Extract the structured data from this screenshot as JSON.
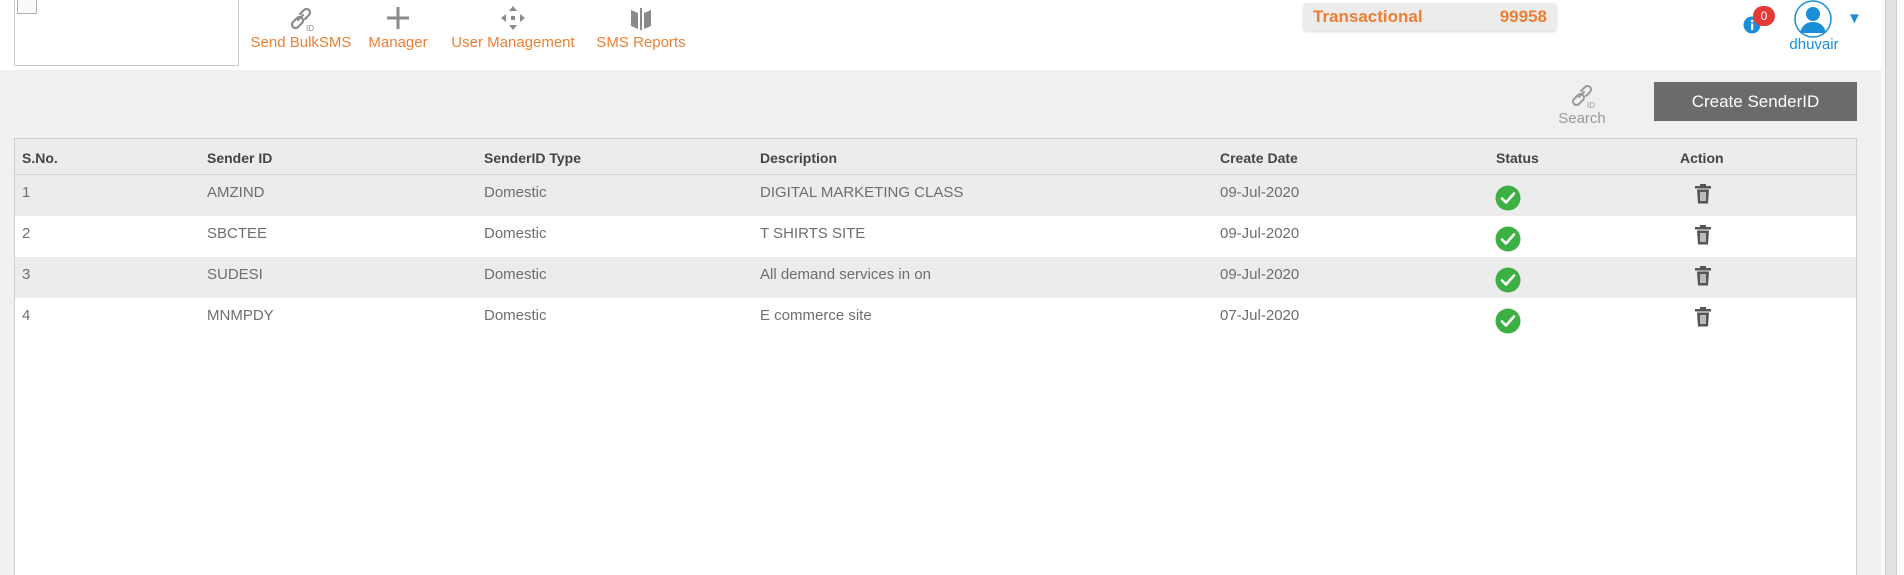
{
  "header": {
    "nav": [
      {
        "label": "Send BulkSMS",
        "icon": "senderid-icon"
      },
      {
        "label": "Manager",
        "icon": "plus-icon"
      },
      {
        "label": "User Management",
        "icon": "users-move-icon"
      },
      {
        "label": "SMS Reports",
        "icon": "reports-icon"
      }
    ],
    "balance": {
      "label": "Transactional",
      "value": "99958"
    },
    "notifications": {
      "count": "0"
    },
    "user": {
      "name": "dhuvair",
      "caret": "▼"
    }
  },
  "toolbar": {
    "search_label": "Search",
    "create_button": "Create SenderID"
  },
  "table": {
    "columns": [
      "S.No.",
      "Sender ID",
      "SenderID Type",
      "Description",
      "Create Date",
      "Status",
      "Action"
    ],
    "rows": [
      {
        "sno": "1",
        "sender_id": "AMZIND",
        "type": "Domestic",
        "description": "DIGITAL MARKETING CLASS",
        "date": "09-Jul-2020",
        "status": "active"
      },
      {
        "sno": "2",
        "sender_id": "SBCTEE",
        "type": "Domestic",
        "description": "T SHIRTS SITE",
        "date": "09-Jul-2020",
        "status": "active"
      },
      {
        "sno": "3",
        "sender_id": "SUDESI",
        "type": "Domestic",
        "description": "All demand services in on",
        "date": "09-Jul-2020",
        "status": "active"
      },
      {
        "sno": "4",
        "sender_id": "MNMPDY",
        "type": "Domestic",
        "description": "E commerce site",
        "date": "07-Jul-2020",
        "status": "active"
      }
    ]
  },
  "colors": {
    "accent_orange": "#ee7f32",
    "user_blue": "#1a8fd8",
    "status_green": "#3cb043",
    "button_gray": "#6b6b6b"
  }
}
